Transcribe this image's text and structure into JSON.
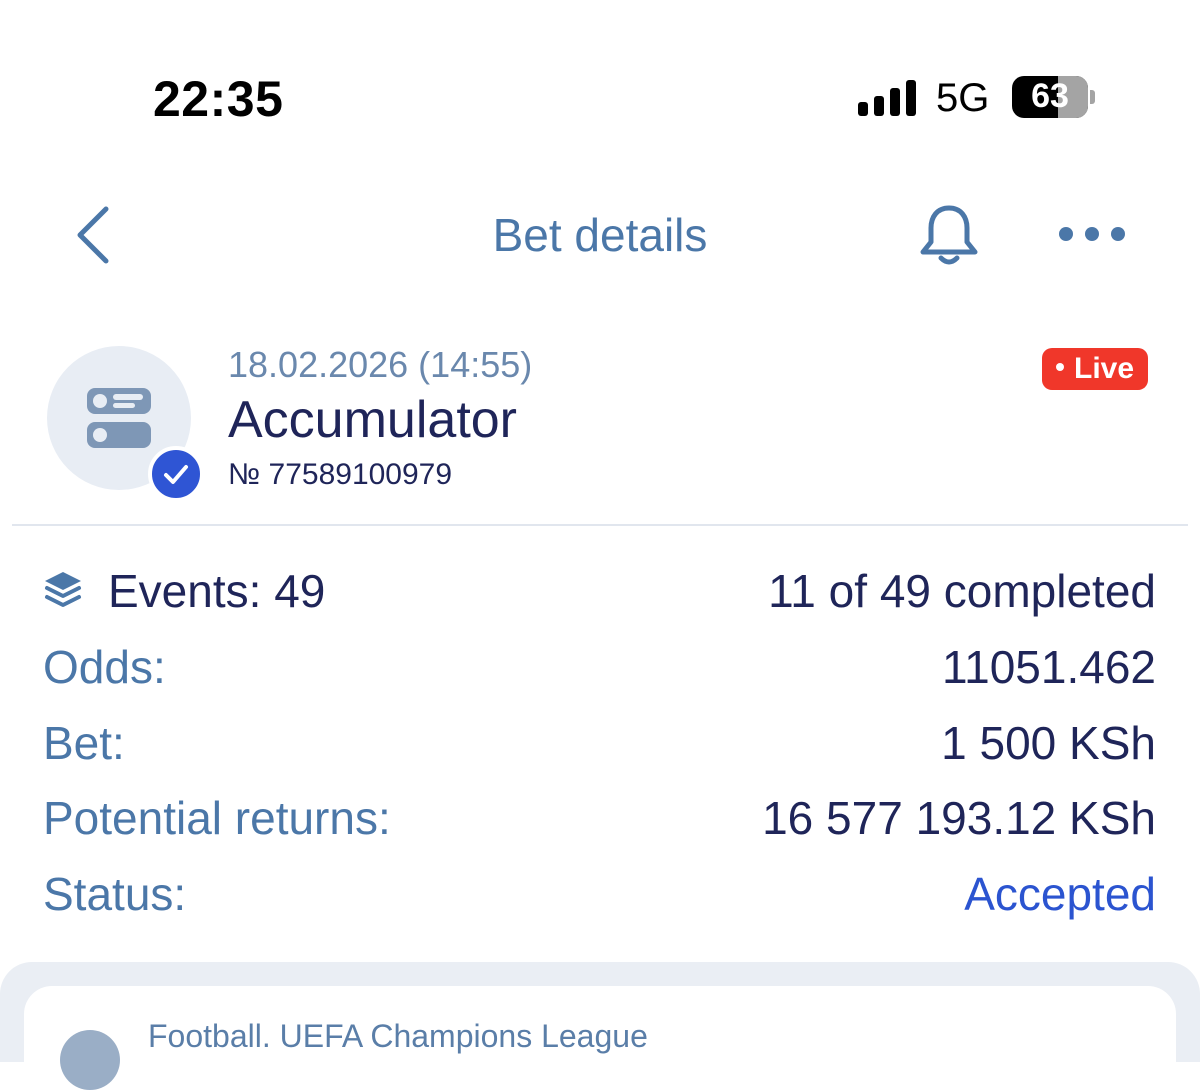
{
  "status_bar": {
    "time": "22:35",
    "network": "5G",
    "battery": "63"
  },
  "header": {
    "title": "Bet details"
  },
  "bet": {
    "datetime": "18.02.2026 (14:55)",
    "type": "Accumulator",
    "number": "№ 77589100979",
    "live_badge": "Live"
  },
  "details": {
    "events_label": "Events: 49",
    "events_value": "11 of 49 completed",
    "odds_label": "Odds:",
    "odds_value": "11051.462",
    "bet_label": "Bet:",
    "bet_value": "1 500 KSh",
    "returns_label": "Potential returns:",
    "returns_value": "16 577 193.12 KSh",
    "status_label": "Status:",
    "status_value": "Accepted"
  },
  "event_card": {
    "league": "Football. UEFA Champions League"
  },
  "colors": {
    "accent_blue": "#2b54d0",
    "label_blue": "#4b77a8",
    "navy_text": "#1f2559",
    "live_red": "#f0372a"
  },
  "icons": [
    "back-chevron-icon",
    "bell-icon",
    "more-dots-icon",
    "bet-slip-icon",
    "checkmark-icon",
    "layers-icon",
    "football-icon"
  ]
}
